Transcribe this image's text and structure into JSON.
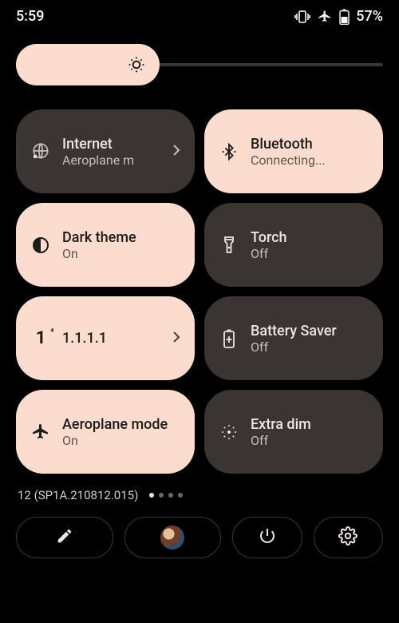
{
  "status": {
    "time": "5:59",
    "battery_pct": "57%"
  },
  "tiles": [
    {
      "id": "internet",
      "title": "Internet",
      "sub": "Aeroplane m",
      "state": "off",
      "hasChevron": true
    },
    {
      "id": "bluetooth",
      "title": "Bluetooth",
      "sub": "Connecting...",
      "state": "on",
      "hasChevron": false
    },
    {
      "id": "dark-theme",
      "title": "Dark theme",
      "sub": "On",
      "state": "on",
      "hasChevron": false
    },
    {
      "id": "torch",
      "title": "Torch",
      "sub": "Off",
      "state": "off",
      "hasChevron": false
    },
    {
      "id": "dns",
      "title": "1.1.1.1",
      "sub": "",
      "state": "on",
      "hasChevron": true
    },
    {
      "id": "battery-saver",
      "title": "Battery Saver",
      "sub": "Off",
      "state": "off",
      "hasChevron": false
    },
    {
      "id": "aeroplane",
      "title": "Aeroplane mode",
      "sub": "On",
      "state": "on",
      "hasChevron": false
    },
    {
      "id": "extra-dim",
      "title": "Extra dim",
      "sub": "Off",
      "state": "off",
      "hasChevron": false
    }
  ],
  "footer": {
    "build": "12 (SP1A.210812.015)"
  },
  "colors": {
    "accent": "#fcdcce",
    "tileOff": "#3a3433"
  }
}
